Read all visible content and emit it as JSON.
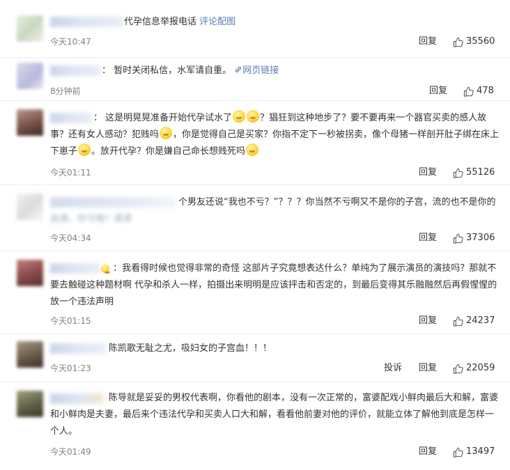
{
  "comments": [
    {
      "text_a": "代孕信息举报电话",
      "text_link": "评论配图",
      "time": "今天10:47",
      "reply": "回复",
      "likes": "35560"
    },
    {
      "text_a": "：  暂时关闭私信，水军请自重。",
      "text_link": "网页链接",
      "time": "8分钟前",
      "reply": "回复",
      "likes": "478"
    },
    {
      "text_a": "：  这是明晃晃准备开始代孕试水了",
      "text_b": "？猖狂到这种地步了？要不要再来一个器官买卖的感人故事？还有女人感动？犯贱吗",
      "text_c": "，你是觉得自己是买家？你指不定下一秒被拐卖，像个母猪一样剖开肚子绑在床上下崽子",
      "text_d": "。放开代孕？你是嫌自己命长想贱死吗",
      "time": "今天01:11",
      "reply": "回复",
      "likes": "55126"
    },
    {
      "text_a": "个男友还说“我也不亏？”？？？你当然不亏啊又不是你的子宫，流的也不是你的",
      "text_b": "血滴，你亏啥？滴滴",
      "time": "今天04:34",
      "reply": "回复",
      "likes": "37306"
    },
    {
      "text_a": "：我看得时候也觉得非常的奇怪 这部片子究竟想表达什么？单纯为了展示演员的演技吗？那就不要去触碰这种题材啊 代孕和杀人一样，拍摄出来明明是应该抨击和否定的，到最后变得其乐融融然后再假惺惺的放一个违法声明",
      "time": "今天01:15",
      "reply": "回复",
      "likes": "24237"
    },
    {
      "text_a": "陈凯歌无耻之尤，吸妇女的子宫血！！！",
      "time": "今天01:23",
      "report": "投诉",
      "reply": "回复",
      "likes": "22059"
    },
    {
      "text_a": "陈导就是妥妥的男权代表啊，你看他的剧本，没有一次正常的，富婆配戏小鲜肉最后大和解，富婆和小鲜肉是夫妻，最后来个违法代孕和买卖人口大和解，看看他前妻对他的评价，就能立体了解他到底是怎样一个人。",
      "time": "今天01:49",
      "reply": "回复",
      "likes": "13497"
    }
  ],
  "colors": {
    "link": "#5a7bb4",
    "time": "#808080",
    "separator": "#ececec"
  },
  "icons": {
    "like": "thumbs-up-icon",
    "link": "link-icon",
    "emoji": "emoji-face-icon"
  }
}
